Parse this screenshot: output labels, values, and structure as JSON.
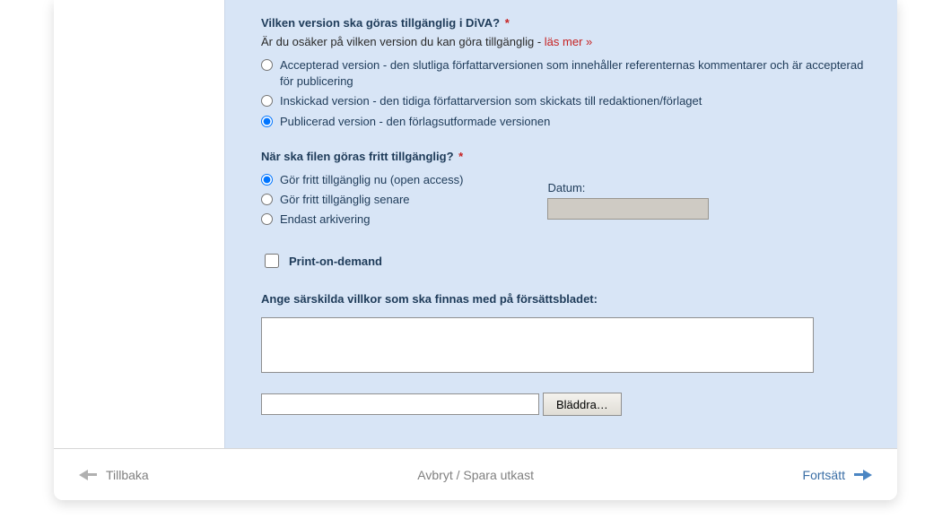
{
  "q1": {
    "heading": "Vilken version ska göras tillgänglig i DiVA?",
    "sub_prefix": "Är du osäker på vilken version du kan göra tillgänglig - ",
    "link_text": "läs mer »",
    "options": {
      "accepted": "Accepterad version - den slutliga författarversionen som innehåller referenternas kommentarer och är accepterad för publicering",
      "submitted": "Inskickad version - den tidiga författarversion som skickats till redaktionen/förlaget",
      "published": "Publicerad version - den förlagsutformade versionen"
    }
  },
  "q2": {
    "heading": "När ska filen göras fritt tillgänglig?",
    "options": {
      "now": "Gör fritt tillgänglig nu (open access)",
      "later": "Gör fritt tillgänglig senare",
      "archive": "Endast arkivering"
    },
    "date_label": "Datum:"
  },
  "pod_label": "Print-on-demand",
  "conditions_label": "Ange särskilda villkor som ska finnas med på försättsbladet:",
  "browse_label": "Bläddra…",
  "footer": {
    "back": "Tillbaka",
    "cancel_save": "Avbryt / Spara utkast",
    "continue": "Fortsätt"
  }
}
